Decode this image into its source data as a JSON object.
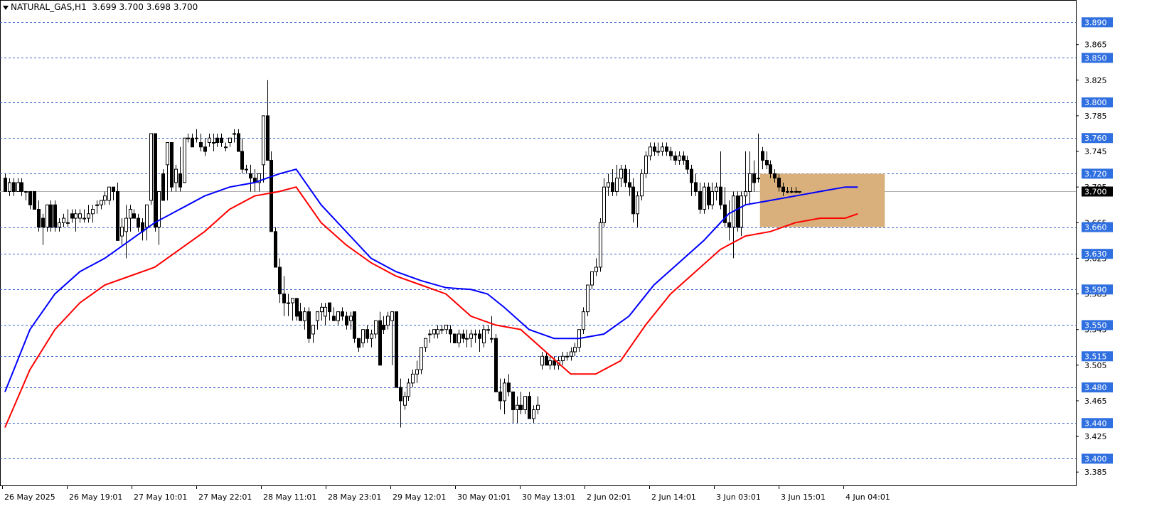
{
  "header": {
    "symbol_tf": "NATURAL_GAS,H1",
    "ohlc": "3.699 3.700 3.698 3.700"
  },
  "colors": {
    "grid_line": "#3a64c8",
    "level_label_bg": "#2f6fe0",
    "current_label_bg": "#000000",
    "ma_fast": "#0000ff",
    "ma_slow": "#ff0000",
    "zone_fill": "#d9b07c",
    "candle_bull_fill": "#ffffff",
    "candle_bear_fill": "#000000"
  },
  "chart_data": {
    "type": "candlestick",
    "ylim": [
      3.37,
      3.915
    ],
    "current_price": "3.700",
    "price_scale_ticks": [
      "3.865",
      "3.825",
      "3.785",
      "3.745",
      "3.705",
      "3.665",
      "3.625",
      "3.585",
      "3.545",
      "3.505",
      "3.465",
      "3.425",
      "3.385"
    ],
    "horizontal_levels": [
      "3.890",
      "3.850",
      "3.800",
      "3.760",
      "3.720",
      "3.660",
      "3.630",
      "3.590",
      "3.550",
      "3.515",
      "3.480",
      "3.440",
      "3.400"
    ],
    "time_labels": [
      "26 May 2025",
      "26 May 19:01",
      "27 May 10:01",
      "27 May 22:01",
      "28 May 11:01",
      "28 May 23:01",
      "29 May 12:01",
      "30 May 01:01",
      "30 May 13:01",
      "2 Jun 02:01",
      "2 Jun 14:01",
      "3 Jun 03:01",
      "3 Jun 15:01",
      "4 Jun 04:01"
    ],
    "zone": {
      "price_top": 3.72,
      "price_bottom": 3.66,
      "bar_start": 181.5,
      "bar_end": 211.5
    },
    "candles": [
      [
        3.715,
        3.72,
        3.705,
        3.7
      ],
      [
        3.7,
        3.715,
        3.695,
        3.71
      ],
      [
        3.71,
        3.715,
        3.695,
        3.7
      ],
      [
        3.7,
        3.715,
        3.7,
        3.71
      ],
      [
        3.71,
        3.715,
        3.695,
        3.7
      ],
      [
        3.7,
        3.7,
        3.69,
        3.7
      ],
      [
        3.7,
        3.7,
        3.68,
        3.685
      ],
      [
        3.7,
        3.7,
        3.68,
        3.68
      ],
      [
        3.68,
        3.69,
        3.655,
        3.66
      ],
      [
        3.67,
        3.675,
        3.64,
        3.66
      ],
      [
        3.66,
        3.685,
        3.655,
        3.685
      ],
      [
        3.685,
        3.69,
        3.655,
        3.66
      ],
      [
        3.685,
        3.69,
        3.655,
        3.66
      ],
      [
        3.66,
        3.67,
        3.655,
        3.665
      ],
      [
        3.665,
        3.675,
        3.66,
        3.67
      ],
      [
        3.665,
        3.68,
        3.66,
        3.665
      ],
      [
        3.675,
        3.68,
        3.665,
        3.67
      ],
      [
        3.67,
        3.68,
        3.655,
        3.675
      ],
      [
        3.67,
        3.68,
        3.665,
        3.675
      ],
      [
        3.67,
        3.68,
        3.665,
        3.67
      ],
      [
        3.67,
        3.685,
        3.665,
        3.675
      ],
      [
        3.675,
        3.685,
        3.665,
        3.68
      ],
      [
        3.685,
        3.69,
        3.675,
        3.685
      ],
      [
        3.685,
        3.69,
        3.68,
        3.69
      ],
      [
        3.69,
        3.7,
        3.685,
        3.695
      ],
      [
        3.69,
        3.7,
        3.685,
        3.705
      ],
      [
        3.705,
        3.7,
        3.69,
        3.7
      ],
      [
        3.7,
        3.71,
        3.645,
        3.645
      ],
      [
        3.65,
        3.67,
        3.64,
        3.66
      ],
      [
        3.655,
        3.685,
        3.625,
        3.67
      ],
      [
        3.67,
        3.685,
        3.655,
        3.68
      ],
      [
        3.675,
        3.68,
        3.67,
        3.67
      ],
      [
        3.67,
        3.675,
        3.655,
        3.66
      ],
      [
        3.665,
        3.67,
        3.645,
        3.655
      ],
      [
        3.66,
        3.685,
        3.645,
        3.685
      ],
      [
        3.69,
        3.765,
        3.685,
        3.765
      ],
      [
        3.765,
        3.765,
        3.655,
        3.66
      ],
      [
        3.66,
        3.7,
        3.64,
        3.7
      ],
      [
        3.72,
        3.725,
        3.69,
        3.69
      ],
      [
        3.73,
        3.755,
        3.69,
        3.755
      ],
      [
        3.755,
        3.755,
        3.7,
        3.705
      ],
      [
        3.71,
        3.73,
        3.7,
        3.725
      ],
      [
        3.72,
        3.75,
        3.7,
        3.705
      ],
      [
        3.71,
        3.76,
        3.71,
        3.76
      ],
      [
        3.76,
        3.765,
        3.755,
        3.76
      ],
      [
        3.76,
        3.765,
        3.755,
        3.75
      ],
      [
        3.76,
        3.77,
        3.755,
        3.76
      ],
      [
        3.755,
        3.765,
        3.745,
        3.75
      ],
      [
        3.75,
        3.76,
        3.74,
        3.745
      ],
      [
        3.755,
        3.765,
        3.75,
        3.76
      ],
      [
        3.755,
        3.765,
        3.745,
        3.755
      ],
      [
        3.76,
        3.765,
        3.75,
        3.755
      ],
      [
        3.76,
        3.765,
        3.75,
        3.755
      ],
      [
        3.75,
        3.755,
        3.745,
        3.75
      ],
      [
        3.755,
        3.76,
        3.75,
        3.76
      ],
      [
        3.765,
        3.77,
        3.755,
        3.765
      ],
      [
        3.765,
        3.77,
        3.745,
        3.745
      ],
      [
        3.745,
        3.76,
        3.72,
        3.725
      ],
      [
        3.725,
        3.73,
        3.72,
        3.725
      ],
      [
        3.72,
        3.73,
        3.7,
        3.715
      ],
      [
        3.715,
        3.725,
        3.7,
        3.71
      ],
      [
        3.71,
        3.72,
        3.7,
        3.72
      ],
      [
        3.73,
        3.785,
        3.71,
        3.785
      ],
      [
        3.785,
        3.825,
        3.735,
        3.735
      ],
      [
        3.735,
        3.745,
        3.655,
        3.655
      ],
      [
        3.655,
        3.66,
        3.615,
        3.615
      ],
      [
        3.615,
        3.625,
        3.575,
        3.585
      ],
      [
        3.585,
        3.605,
        3.56,
        3.575
      ],
      [
        3.575,
        3.585,
        3.56,
        3.575
      ],
      [
        3.575,
        3.58,
        3.555,
        3.58
      ],
      [
        3.58,
        3.58,
        3.555,
        3.56
      ],
      [
        3.565,
        3.575,
        3.555,
        3.555
      ],
      [
        3.555,
        3.57,
        3.545,
        3.565
      ],
      [
        3.565,
        3.57,
        3.53,
        3.535
      ],
      [
        3.54,
        3.55,
        3.53,
        3.55
      ],
      [
        3.555,
        3.565,
        3.545,
        3.565
      ],
      [
        3.565,
        3.575,
        3.555,
        3.57
      ],
      [
        3.56,
        3.575,
        3.55,
        3.57
      ],
      [
        3.575,
        3.575,
        3.555,
        3.565
      ],
      [
        3.56,
        3.57,
        3.555,
        3.555
      ],
      [
        3.555,
        3.565,
        3.55,
        3.565
      ],
      [
        3.565,
        3.57,
        3.555,
        3.56
      ],
      [
        3.56,
        3.565,
        3.545,
        3.55
      ],
      [
        3.555,
        3.565,
        3.545,
        3.56
      ],
      [
        3.565,
        3.565,
        3.53,
        3.535
      ],
      [
        3.535,
        3.535,
        3.52,
        3.525
      ],
      [
        3.53,
        3.545,
        3.525,
        3.545
      ],
      [
        3.545,
        3.55,
        3.53,
        3.535
      ],
      [
        3.535,
        3.545,
        3.525,
        3.54
      ],
      [
        3.54,
        3.555,
        3.535,
        3.555
      ],
      [
        3.555,
        3.565,
        3.505,
        3.505
      ],
      [
        3.55,
        3.56,
        3.54,
        3.545
      ],
      [
        3.55,
        3.565,
        3.545,
        3.56
      ],
      [
        3.555,
        3.565,
        3.505,
        3.565
      ],
      [
        3.565,
        3.565,
        3.48,
        3.48
      ],
      [
        3.48,
        3.49,
        3.435,
        3.465
      ],
      [
        3.46,
        3.475,
        3.455,
        3.47
      ],
      [
        3.47,
        3.49,
        3.465,
        3.485
      ],
      [
        3.485,
        3.5,
        3.48,
        3.495
      ],
      [
        3.495,
        3.51,
        3.485,
        3.5
      ],
      [
        3.5,
        3.525,
        3.495,
        3.525
      ],
      [
        3.525,
        3.535,
        3.52,
        3.535
      ],
      [
        3.54,
        3.545,
        3.53,
        3.54
      ],
      [
        3.54,
        3.545,
        3.535,
        3.545
      ],
      [
        3.54,
        3.55,
        3.535,
        3.545
      ],
      [
        3.545,
        3.55,
        3.54,
        3.545
      ],
      [
        3.545,
        3.55,
        3.54,
        3.55
      ],
      [
        3.545,
        3.55,
        3.53,
        3.54
      ],
      [
        3.54,
        3.54,
        3.53,
        3.53
      ],
      [
        3.53,
        3.545,
        3.525,
        3.54
      ],
      [
        3.54,
        3.545,
        3.53,
        3.535
      ],
      [
        3.535,
        3.545,
        3.525,
        3.535
      ],
      [
        3.535,
        3.545,
        3.525,
        3.54
      ],
      [
        3.54,
        3.545,
        3.53,
        3.54
      ],
      [
        3.54,
        3.545,
        3.52,
        3.535
      ],
      [
        3.53,
        3.55,
        3.525,
        3.545
      ],
      [
        3.545,
        3.55,
        3.54,
        3.545
      ],
      [
        3.535,
        3.56,
        3.53,
        3.535
      ],
      [
        3.535,
        3.54,
        3.475,
        3.475
      ],
      [
        3.475,
        3.49,
        3.455,
        3.465
      ],
      [
        3.465,
        3.49,
        3.45,
        3.485
      ],
      [
        3.485,
        3.495,
        3.47,
        3.475
      ],
      [
        3.475,
        3.475,
        3.44,
        3.455
      ],
      [
        3.455,
        3.47,
        3.44,
        3.46
      ],
      [
        3.46,
        3.475,
        3.45,
        3.455
      ],
      [
        3.455,
        3.47,
        3.45,
        3.47
      ],
      [
        3.47,
        3.475,
        3.445,
        3.445
      ],
      [
        3.445,
        3.46,
        3.44,
        3.455
      ],
      [
        3.455,
        3.47,
        3.45,
        3.46
      ],
      [
        3.505,
        3.52,
        3.5,
        3.515
      ],
      [
        3.515,
        3.52,
        3.505,
        3.505
      ],
      [
        3.505,
        3.515,
        3.5,
        3.51
      ],
      [
        3.51,
        3.515,
        3.5,
        3.505
      ],
      [
        3.505,
        3.515,
        3.5,
        3.51
      ],
      [
        3.51,
        3.52,
        3.505,
        3.515
      ],
      [
        3.515,
        3.52,
        3.51,
        3.515
      ],
      [
        3.515,
        3.525,
        3.51,
        3.52
      ],
      [
        3.52,
        3.53,
        3.515,
        3.525
      ],
      [
        3.525,
        3.545,
        3.52,
        3.545
      ],
      [
        3.545,
        3.57,
        3.54,
        3.565
      ],
      [
        3.565,
        3.595,
        3.56,
        3.595
      ],
      [
        3.595,
        3.61,
        3.59,
        3.61
      ],
      [
        3.61,
        3.625,
        3.605,
        3.615
      ],
      [
        3.615,
        3.67,
        3.61,
        3.665
      ],
      [
        3.665,
        3.715,
        3.66,
        3.705
      ],
      [
        3.705,
        3.72,
        3.695,
        3.71
      ],
      [
        3.71,
        3.725,
        3.695,
        3.7
      ],
      [
        3.7,
        3.73,
        3.695,
        3.715
      ],
      [
        3.715,
        3.73,
        3.705,
        3.725
      ],
      [
        3.725,
        3.73,
        3.705,
        3.71
      ],
      [
        3.71,
        3.725,
        3.695,
        3.705
      ],
      [
        3.705,
        3.715,
        3.665,
        3.675
      ],
      [
        3.675,
        3.7,
        3.66,
        3.695
      ],
      [
        3.695,
        3.725,
        3.69,
        3.72
      ],
      [
        3.72,
        3.745,
        3.715,
        3.74
      ],
      [
        3.74,
        3.755,
        3.735,
        3.75
      ],
      [
        3.75,
        3.755,
        3.74,
        3.745
      ],
      [
        3.745,
        3.755,
        3.74,
        3.745
      ],
      [
        3.745,
        3.755,
        3.74,
        3.75
      ],
      [
        3.75,
        3.755,
        3.74,
        3.745
      ],
      [
        3.745,
        3.75,
        3.735,
        3.74
      ],
      [
        3.74,
        3.745,
        3.73,
        3.735
      ],
      [
        3.735,
        3.745,
        3.73,
        3.74
      ],
      [
        3.74,
        3.745,
        3.73,
        3.735
      ],
      [
        3.735,
        3.74,
        3.72,
        3.725
      ],
      [
        3.725,
        3.73,
        3.695,
        3.71
      ],
      [
        3.71,
        3.72,
        3.695,
        3.7
      ],
      [
        3.7,
        3.71,
        3.675,
        3.68
      ],
      [
        3.68,
        3.71,
        3.675,
        3.705
      ],
      [
        3.705,
        3.71,
        3.68,
        3.685
      ],
      [
        3.685,
        3.71,
        3.68,
        3.7
      ],
      [
        3.7,
        3.71,
        3.69,
        3.705
      ],
      [
        3.705,
        3.745,
        3.68,
        3.685
      ],
      [
        3.685,
        3.705,
        3.66,
        3.665
      ],
      [
        3.665,
        3.69,
        3.645,
        3.66
      ],
      [
        3.66,
        3.7,
        3.625,
        3.695
      ],
      [
        3.695,
        3.7,
        3.655,
        3.66
      ],
      [
        3.66,
        3.7,
        3.65,
        3.695
      ],
      [
        3.695,
        3.745,
        3.685,
        3.7
      ],
      [
        3.7,
        3.745,
        3.685,
        3.72
      ],
      [
        3.72,
        3.735,
        3.7,
        3.71
      ],
      [
        3.715,
        3.765,
        3.71,
        3.715
      ],
      [
        3.745,
        3.75,
        3.725,
        3.735
      ],
      [
        3.735,
        3.745,
        3.725,
        3.73
      ],
      [
        3.73,
        3.735,
        3.715,
        3.72
      ],
      [
        3.72,
        3.725,
        3.71,
        3.715
      ],
      [
        3.715,
        3.72,
        3.7,
        3.705
      ],
      [
        3.705,
        3.71,
        3.695,
        3.7
      ],
      [
        3.7,
        3.705,
        3.698,
        3.7
      ],
      [
        3.7,
        3.705,
        3.698,
        3.7
      ],
      [
        3.7,
        3.705,
        3.698,
        3.7
      ],
      [
        3.699,
        3.7,
        3.698,
        3.7
      ]
    ],
    "ma_fast": [
      [
        0,
        3.475
      ],
      [
        6,
        3.545
      ],
      [
        12,
        3.585
      ],
      [
        18,
        3.61
      ],
      [
        24,
        3.625
      ],
      [
        30,
        3.645
      ],
      [
        36,
        3.665
      ],
      [
        42,
        3.68
      ],
      [
        48,
        3.695
      ],
      [
        54,
        3.705
      ],
      [
        60,
        3.71
      ],
      [
        66,
        3.72
      ],
      [
        70,
        3.725
      ],
      [
        76,
        3.685
      ],
      [
        82,
        3.655
      ],
      [
        88,
        3.625
      ],
      [
        94,
        3.61
      ],
      [
        100,
        3.6
      ],
      [
        106,
        3.592
      ],
      [
        112,
        3.59
      ],
      [
        116,
        3.585
      ],
      [
        120,
        3.57
      ],
      [
        126,
        3.545
      ],
      [
        132,
        3.535
      ],
      [
        138,
        3.535
      ],
      [
        144,
        3.54
      ],
      [
        150,
        3.56
      ],
      [
        156,
        3.595
      ],
      [
        162,
        3.62
      ],
      [
        168,
        3.645
      ],
      [
        174,
        3.675
      ],
      [
        178,
        3.685
      ],
      [
        184,
        3.69
      ],
      [
        190,
        3.695
      ],
      [
        196,
        3.7
      ],
      [
        202,
        3.705
      ],
      [
        205,
        3.705
      ]
    ],
    "ma_slow": [
      [
        0,
        3.435
      ],
      [
        6,
        3.5
      ],
      [
        12,
        3.545
      ],
      [
        18,
        3.575
      ],
      [
        24,
        3.595
      ],
      [
        30,
        3.605
      ],
      [
        36,
        3.615
      ],
      [
        42,
        3.635
      ],
      [
        48,
        3.655
      ],
      [
        54,
        3.68
      ],
      [
        60,
        3.695
      ],
      [
        66,
        3.7
      ],
      [
        70,
        3.705
      ],
      [
        76,
        3.665
      ],
      [
        82,
        3.64
      ],
      [
        88,
        3.62
      ],
      [
        94,
        3.605
      ],
      [
        100,
        3.595
      ],
      [
        106,
        3.585
      ],
      [
        112,
        3.56
      ],
      [
        118,
        3.55
      ],
      [
        124,
        3.545
      ],
      [
        130,
        3.52
      ],
      [
        136,
        3.495
      ],
      [
        142,
        3.495
      ],
      [
        148,
        3.51
      ],
      [
        154,
        3.55
      ],
      [
        160,
        3.585
      ],
      [
        166,
        3.61
      ],
      [
        172,
        3.635
      ],
      [
        178,
        3.65
      ],
      [
        184,
        3.655
      ],
      [
        190,
        3.665
      ],
      [
        196,
        3.67
      ],
      [
        202,
        3.67
      ],
      [
        205,
        3.675
      ]
    ]
  }
}
